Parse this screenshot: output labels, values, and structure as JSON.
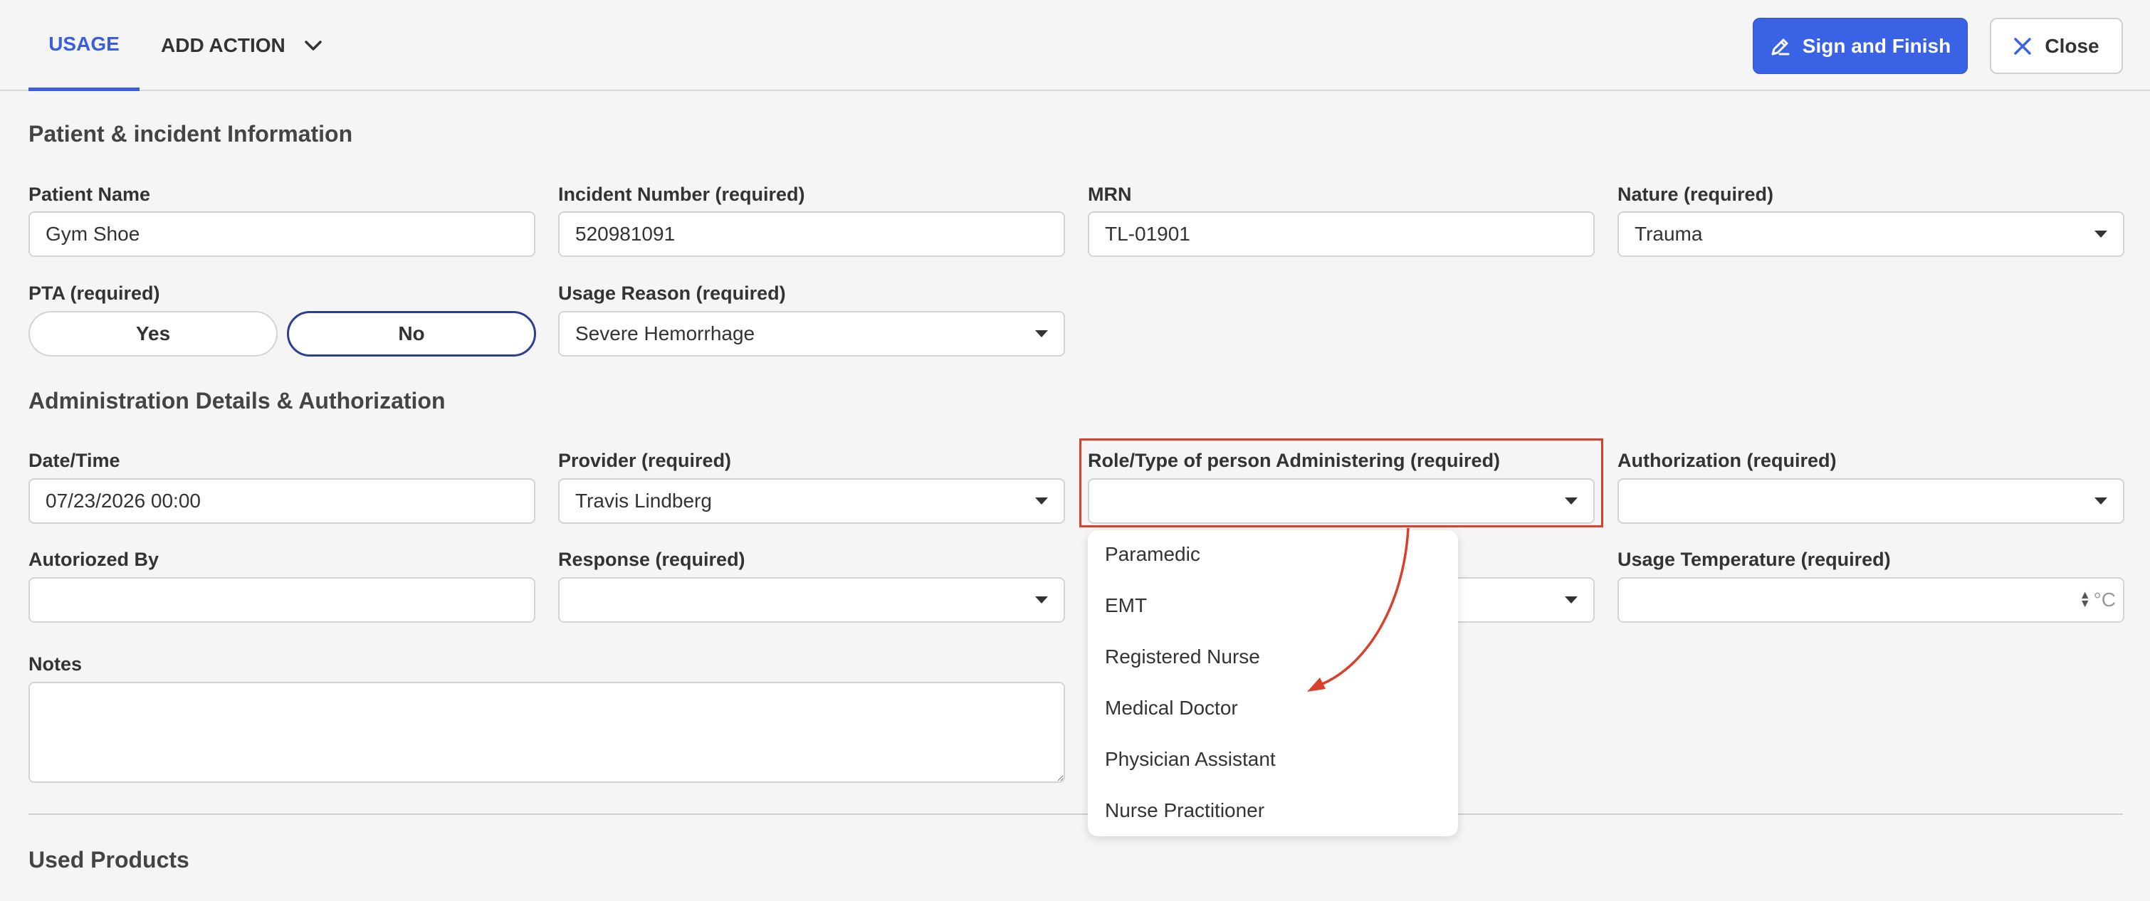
{
  "header": {
    "tab_usage": "USAGE",
    "tab_add_action": "ADD ACTION",
    "sign_button": "Sign and Finish",
    "close_button": "Close"
  },
  "section_patient": {
    "title": "Patient & incident Information",
    "patient_name": {
      "label": "Patient Name",
      "value": "Gym Shoe"
    },
    "incident_number": {
      "label": "Incident Number (required)",
      "value": "520981091"
    },
    "mrn": {
      "label": "MRN",
      "value": "TL-01901"
    },
    "nature": {
      "label": "Nature (required)",
      "value": "Trauma"
    },
    "pta": {
      "label": "PTA (required)",
      "yes": "Yes",
      "no": "No",
      "selected": "No"
    },
    "usage_reason": {
      "label": "Usage Reason (required)",
      "value": "Severe Hemorrhage"
    }
  },
  "section_admin": {
    "title": "Administration Details & Authorization",
    "datetime": {
      "label": "Date/Time",
      "value": "07/23/2026 00:00"
    },
    "provider": {
      "label": "Provider (required)",
      "value": "Travis Lindberg"
    },
    "role": {
      "label": "Role/Type of person Administering (required)",
      "value": "",
      "options": [
        "Paramedic",
        "EMT",
        "Registered Nurse",
        "Medical Doctor",
        "Physician Assistant",
        "Nurse Practitioner"
      ]
    },
    "authorization": {
      "label": "Authorization (required)",
      "value": ""
    },
    "authorized_by": {
      "label": "Autoriozed By",
      "value": ""
    },
    "response": {
      "label": "Response (required)",
      "value": ""
    },
    "usage_temperature": {
      "label": "Usage Temperature (required)",
      "value": "",
      "unit": "°C"
    },
    "notes": {
      "label": "Notes",
      "value": ""
    }
  },
  "section_products": {
    "title": "Used Products"
  },
  "colors": {
    "accent": "#3a62e4",
    "highlight": "#d9412d",
    "toggle_selected_border": "#2d3f8f"
  }
}
